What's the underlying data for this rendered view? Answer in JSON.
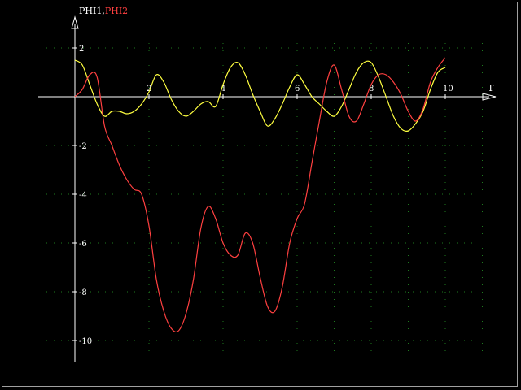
{
  "chart_data": {
    "type": "line",
    "title_parts": [
      {
        "text": "PHI1,",
        "color": "#ffffff"
      },
      {
        "text": "PHI2",
        "color": "#ff4040"
      }
    ],
    "xlabel": "T",
    "ylabel": "",
    "xlim": [
      0,
      11
    ],
    "ylim": [
      -11,
      3
    ],
    "x_ticks": [
      2,
      4,
      6,
      8,
      10
    ],
    "y_ticks": [
      2,
      -2,
      -4,
      -6,
      -8,
      -10
    ],
    "grid": "dotted",
    "series": [
      {
        "name": "PHI1",
        "color": "#ffff40",
        "x": [
          0,
          0.2,
          0.4,
          0.6,
          0.8,
          1.0,
          1.2,
          1.4,
          1.6,
          1.8,
          2.0,
          2.2,
          2.4,
          2.6,
          2.8,
          3.0,
          3.2,
          3.4,
          3.6,
          3.8,
          4.0,
          4.2,
          4.4,
          4.6,
          4.8,
          5.0,
          5.2,
          5.4,
          5.6,
          5.8,
          6.0,
          6.2,
          6.4,
          6.6,
          6.8,
          7.0,
          7.2,
          7.4,
          7.6,
          7.8,
          8.0,
          8.2,
          8.4,
          8.6,
          8.8,
          9.0,
          9.2,
          9.4,
          9.6,
          9.8,
          10.0
        ],
        "y": [
          1.5,
          1.3,
          0.5,
          -0.3,
          -0.8,
          -0.6,
          -0.6,
          -0.7,
          -0.6,
          -0.3,
          0.2,
          0.9,
          0.6,
          -0.1,
          -0.6,
          -0.8,
          -0.6,
          -0.3,
          -0.2,
          -0.4,
          0.5,
          1.2,
          1.4,
          0.9,
          0.1,
          -0.6,
          -1.2,
          -0.9,
          -0.3,
          0.4,
          0.9,
          0.5,
          0.0,
          -0.3,
          -0.6,
          -0.8,
          -0.4,
          0.3,
          1.0,
          1.4,
          1.4,
          0.8,
          0.0,
          -0.8,
          -1.3,
          -1.4,
          -1.1,
          -0.6,
          0.3,
          1.0,
          1.2
        ]
      },
      {
        "name": "PHI2",
        "color": "#ff4040",
        "x": [
          0,
          0.2,
          0.4,
          0.6,
          0.8,
          1.0,
          1.2,
          1.4,
          1.6,
          1.8,
          2.0,
          2.2,
          2.4,
          2.6,
          2.8,
          3.0,
          3.2,
          3.4,
          3.6,
          3.8,
          4.0,
          4.2,
          4.4,
          4.6,
          4.8,
          5.0,
          5.2,
          5.4,
          5.6,
          5.8,
          6.0,
          6.2,
          6.4,
          6.6,
          6.8,
          7.0,
          7.2,
          7.4,
          7.6,
          7.8,
          8.0,
          8.2,
          8.4,
          8.6,
          8.8,
          9.0,
          9.2,
          9.4,
          9.6,
          9.8,
          10.0
        ],
        "y": [
          0.0,
          0.3,
          0.9,
          0.8,
          -1.2,
          -2.0,
          -2.8,
          -3.4,
          -3.8,
          -4.0,
          -5.3,
          -7.5,
          -8.8,
          -9.5,
          -9.6,
          -8.9,
          -7.5,
          -5.4,
          -4.5,
          -5.0,
          -6.0,
          -6.5,
          -6.5,
          -5.6,
          -6.0,
          -7.4,
          -8.6,
          -8.8,
          -7.8,
          -6.0,
          -5.0,
          -4.4,
          -2.7,
          -1.0,
          0.6,
          1.3,
          0.3,
          -0.8,
          -1.0,
          -0.3,
          0.5,
          0.9,
          0.9,
          0.6,
          0.1,
          -0.6,
          -1.0,
          -0.5,
          0.6,
          1.2,
          1.6
        ]
      }
    ]
  }
}
